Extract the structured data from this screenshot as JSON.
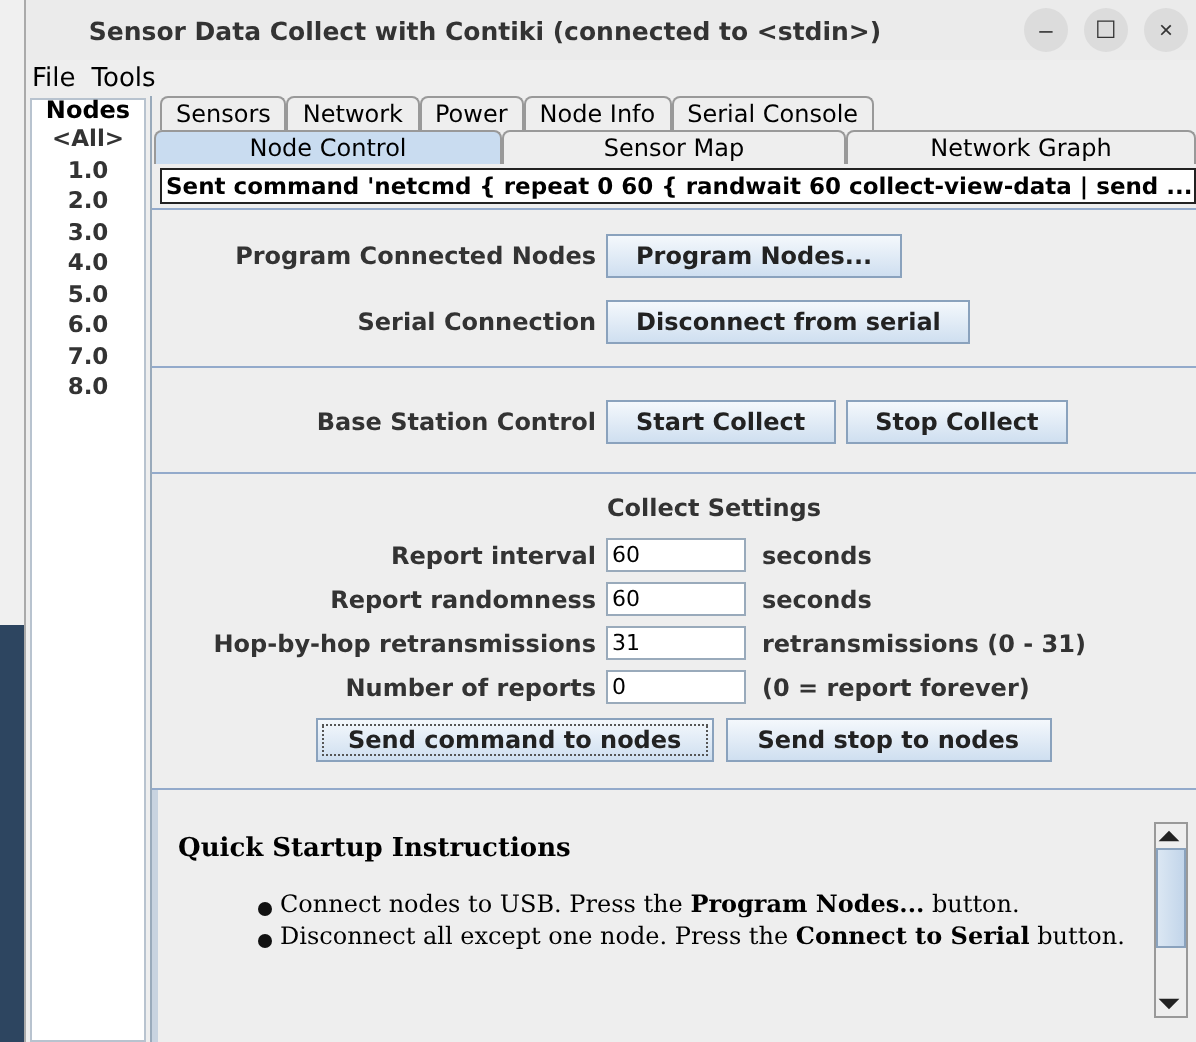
{
  "window": {
    "title": "Sensor Data Collect with Contiki (connected to <stdin>)",
    "controls": [
      "–",
      "☐",
      "×"
    ]
  },
  "menu": [
    {
      "label": "File"
    },
    {
      "label": "Tools"
    }
  ],
  "nodes": {
    "title": "Nodes",
    "items": [
      {
        "label": "<All>"
      },
      {
        "label": "1.0"
      },
      {
        "label": "2.0"
      },
      {
        "label": "3.0"
      },
      {
        "label": "4.0"
      },
      {
        "label": "5.0"
      },
      {
        "label": "6.0"
      },
      {
        "label": "7.0"
      },
      {
        "label": "8.0"
      }
    ]
  },
  "tabs_row_1": [
    {
      "label": "Sensors",
      "selected": false
    },
    {
      "label": "Network",
      "selected": false
    },
    {
      "label": "Power",
      "selected": false
    },
    {
      "label": "Node Info",
      "selected": false
    },
    {
      "label": "Serial Console",
      "selected": false
    }
  ],
  "tabs_row_2": [
    {
      "label": "Node Control",
      "selected": true
    },
    {
      "label": "Sensor Map",
      "selected": false
    },
    {
      "label": "Network Graph",
      "selected": false
    }
  ],
  "status": "Sent command 'netcmd { repeat 0 60 { randwait 60 collect-view-data | send ...",
  "program_section": [
    {
      "label": "Program Connected Nodes",
      "button": "Program Nodes..."
    },
    {
      "label": "Serial Connection",
      "button": "Disconnect from serial"
    }
  ],
  "base_station": {
    "label": "Base Station Control",
    "buttons": [
      "Start Collect",
      "Stop Collect"
    ]
  },
  "collect_settings": {
    "title": "Collect Settings",
    "fields": [
      {
        "label": "Report interval",
        "value": "60",
        "unit": "seconds"
      },
      {
        "label": "Report randomness",
        "value": "60",
        "unit": "seconds"
      },
      {
        "label": "Hop-by-hop retransmissions",
        "value": "31",
        "unit": "retransmissions (0 - 31)"
      },
      {
        "label": "Number of reports",
        "value": "0",
        "unit": "(0 = report forever)"
      }
    ],
    "buttons": [
      {
        "label": "Send command to nodes",
        "focused": true
      },
      {
        "label": "Send stop to nodes",
        "focused": false
      }
    ]
  },
  "instructions": {
    "title": "Quick Startup Instructions",
    "items": [
      "Connect nodes to USB. Press the **Program Nodes...** button.",
      "Disconnect all except one node. Press the **Connect to Serial** button."
    ]
  }
}
